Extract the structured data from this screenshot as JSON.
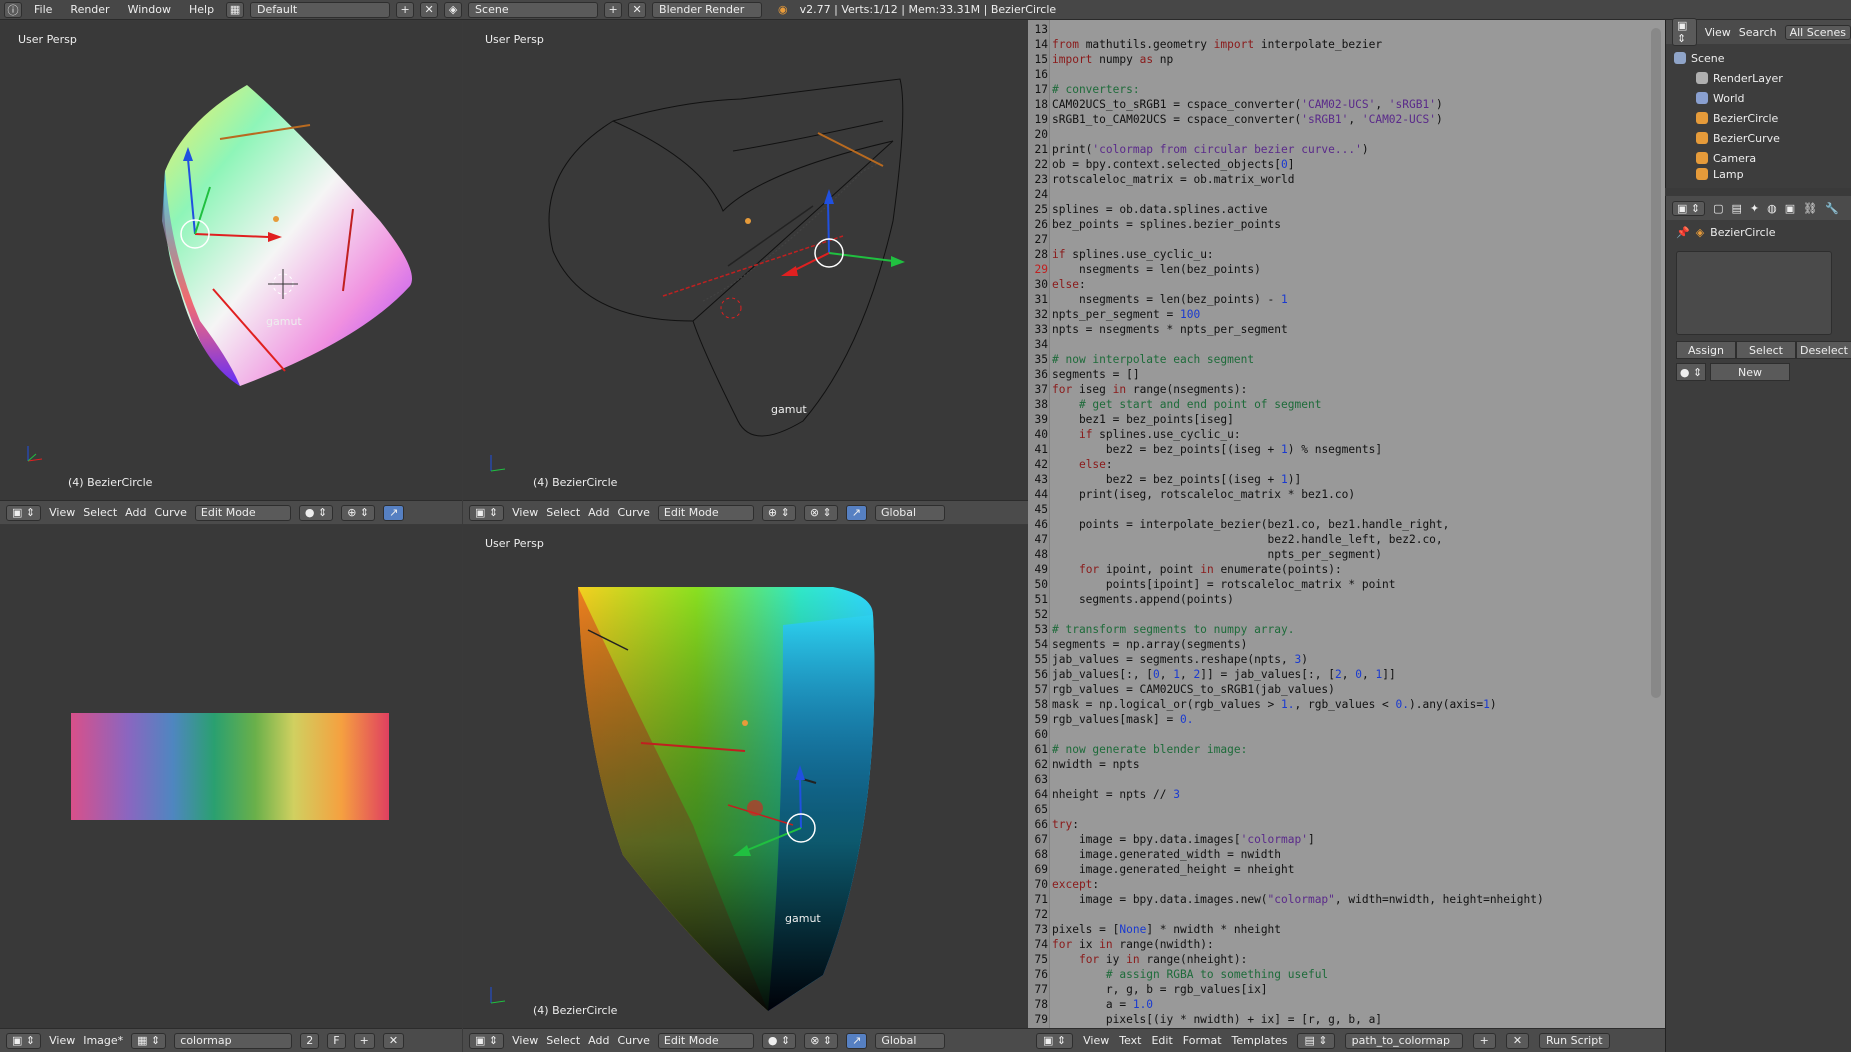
{
  "topbar": {
    "menus": [
      "File",
      "Render",
      "Window",
      "Help"
    ],
    "layout": "Default",
    "scene": "Scene",
    "engine": "Blender Render",
    "info": "v2.77 | Verts:1/12 | Mem:33.31M | BezierCircle"
  },
  "viewports": {
    "top_left": {
      "persp": "User Persp",
      "object": "(4) BezierCircle",
      "label": "gamut"
    },
    "top_mid": {
      "persp": "User Persp",
      "object": "(4) BezierCircle",
      "label": "gamut"
    },
    "bottom_left": {
      "persp": "",
      "object": ""
    },
    "bottom_mid": {
      "persp": "User Persp",
      "object": "(4) BezierCircle",
      "label": "gamut"
    }
  },
  "vp_header": {
    "view": "View",
    "select": "Select",
    "add": "Add",
    "curve": "Curve",
    "mode": "Edit Mode",
    "orientation": "Global"
  },
  "image_header": {
    "view": "View",
    "image": "Image*",
    "name": "colormap",
    "users": "2",
    "fake": "F"
  },
  "editor": {
    "first_line": 13,
    "footer": {
      "view": "View",
      "text": "Text",
      "edit": "Edit",
      "format": "Format",
      "templates": "Templates",
      "filename": "path_to_colormap",
      "run": "Run Script"
    }
  },
  "outliner": {
    "view": "View",
    "search": "Search",
    "filter": "All Scenes",
    "items": [
      {
        "name": "Scene",
        "color": "#8fa4c8",
        "indent": 0
      },
      {
        "name": "RenderLayer",
        "color": "#b0b0b0",
        "indent": 1
      },
      {
        "name": "World",
        "color": "#8aa0d0",
        "indent": 1
      },
      {
        "name": "BezierCircle",
        "color": "#e69b3a",
        "indent": 1
      },
      {
        "name": "BezierCurve",
        "color": "#e69b3a",
        "indent": 1
      },
      {
        "name": "Camera",
        "color": "#e69b3a",
        "indent": 1
      },
      {
        "name": "Lamp",
        "color": "#e69b3a",
        "indent": 1
      }
    ]
  },
  "properties": {
    "object": "BezierCircle",
    "assign": "Assign",
    "select": "Select",
    "deselect": "Deselect",
    "new": "New"
  }
}
